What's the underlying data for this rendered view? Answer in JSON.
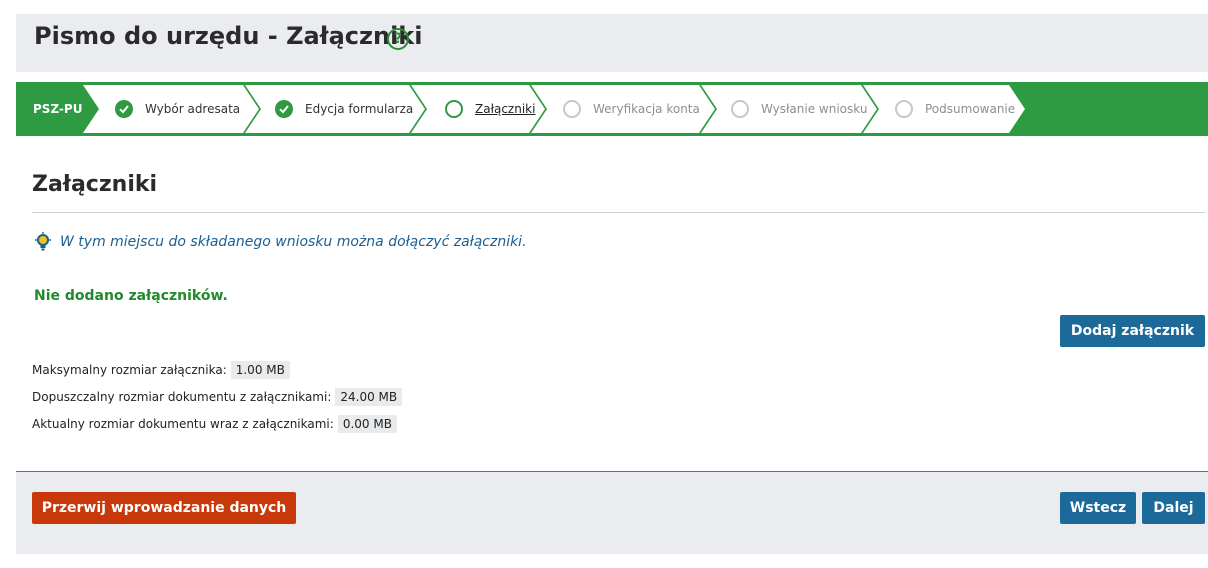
{
  "header": {
    "title": "Pismo do urzędu - Załączniki",
    "help_icon_glyph": "?"
  },
  "stepper": {
    "code": "PSZ-PU",
    "steps": [
      {
        "label": "Wybór adresata",
        "state": "done"
      },
      {
        "label": "Edycja formularza",
        "state": "done"
      },
      {
        "label": "Załączniki",
        "state": "current"
      },
      {
        "label": "Weryfikacja konta",
        "state": "todo"
      },
      {
        "label": "Wysłanie wniosku",
        "state": "todo"
      },
      {
        "label": "Podsumowanie",
        "state": "todo"
      }
    ]
  },
  "section": {
    "title": "Załączniki",
    "info": "W tym miejscu do składanego wniosku można dołączyć załączniki.",
    "empty_message": "Nie dodano załączników."
  },
  "buttons": {
    "add": "Dodaj załącznik",
    "cancel": "Przerwij wprowadzanie danych",
    "back": "Wstecz",
    "next": "Dalej"
  },
  "limits": {
    "max_attachment_label": "Maksymalny rozmiar załącznika:",
    "max_attachment_value": "1.00 MB",
    "max_document_label": "Dopuszczalny rozmiar dokumentu z załącznikami:",
    "max_document_value": "24.00 MB",
    "current_document_label": "Aktualny rozmiar dokumentu wraz z załącznikami:",
    "current_document_value": "0.00 MB"
  },
  "colors": {
    "primary_green": "#2e9b43",
    "button_blue": "#1b6a9a",
    "button_red": "#c7380a",
    "info_blue": "#1a5f93"
  }
}
